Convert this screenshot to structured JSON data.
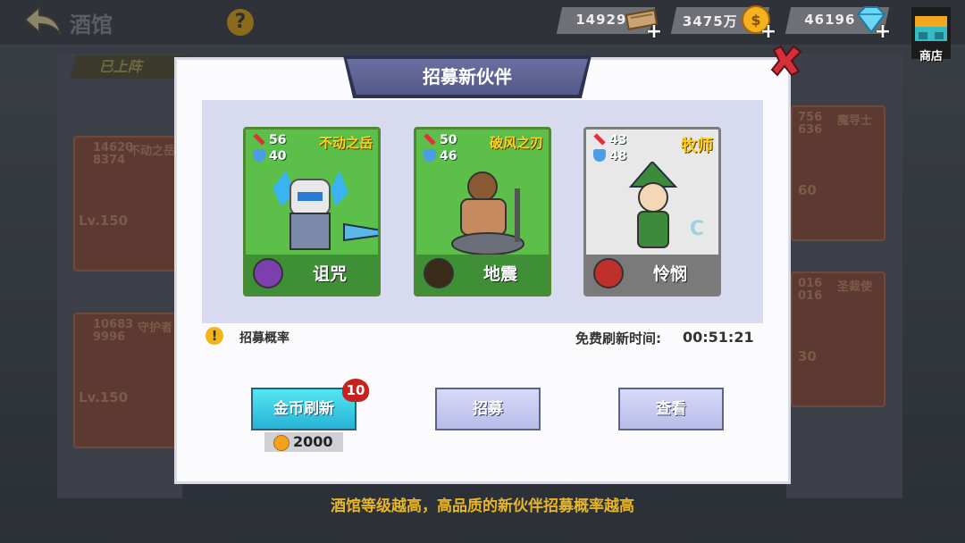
{
  "topbar": {
    "title": "酒馆",
    "help": "?",
    "resources": [
      {
        "value": "14929",
        "icon": "wood-plank-icon"
      },
      {
        "value": "3475万",
        "icon": "gold-coin-icon"
      },
      {
        "value": "46196",
        "icon": "diamond-icon"
      }
    ],
    "shop_label": "商店"
  },
  "background": {
    "tab": "已上阵",
    "cards": [
      {
        "stat1": "14620",
        "stat2": "8374",
        "name": "不动之岳",
        "level": "Lv.150"
      },
      {
        "stat1": "10683",
        "stat2": "9996",
        "name": "守护者",
        "level": "Lv.150"
      },
      {
        "stat1": "756",
        "stat2": "636",
        "name": "魔导士",
        "level": "60"
      },
      {
        "stat1": "016",
        "stat2": "016",
        "name": "圣裁使",
        "level": "30"
      }
    ]
  },
  "modal": {
    "title": "招募新伙伴",
    "heroes": [
      {
        "attack": "56",
        "defense": "40",
        "name": "不动之岳",
        "skill": "诅咒",
        "style": "green",
        "skill_color": "#7b3fb0"
      },
      {
        "attack": "50",
        "defense": "46",
        "name": "破风之刃",
        "skill": "地震",
        "style": "green",
        "skill_color": "#3a2a1a"
      },
      {
        "attack": "43",
        "defense": "48",
        "name": "牧师",
        "skill": "怜悯",
        "style": "white",
        "skill_color": "#c0302a"
      }
    ],
    "rate_label": "招募概率",
    "timer_label": "免费刷新时间:",
    "timer_value": "00:51:21",
    "buttons": {
      "gold_refresh": "金币刷新",
      "gold_refresh_badge": "10",
      "gold_cost": "2000",
      "recruit": "招募",
      "view": "查看"
    }
  },
  "hint": "酒馆等级越高，高品质的新伙伴招募概率越高"
}
